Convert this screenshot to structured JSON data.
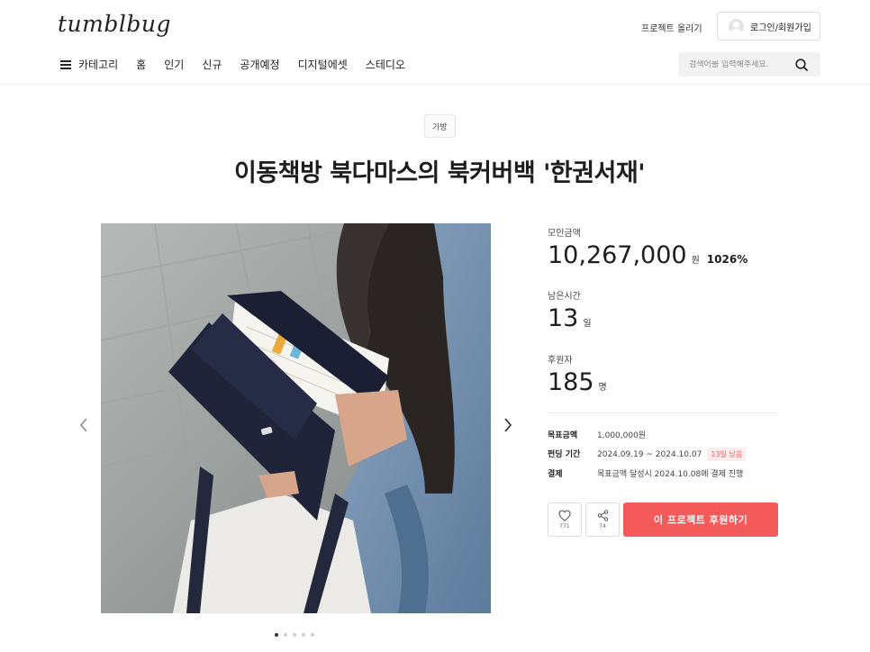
{
  "header": {
    "logo": "tumblbug",
    "project_link": "프로젝트 올리기",
    "login": "로그인/회원가입"
  },
  "nav": {
    "category": "카테고리",
    "items": [
      "홈",
      "인기",
      "신규",
      "공개예정",
      "디지털에셋",
      "스테디오"
    ]
  },
  "search": {
    "placeholder": "검색어를 입력해주세요."
  },
  "project": {
    "category_tag": "가방",
    "title": "이동책방 북다마스의 북커버백 '한권서재'"
  },
  "carousel": {
    "total": 5,
    "active": 1
  },
  "stats": {
    "amount_label": "모인금액",
    "amount": "10,267,000",
    "amount_unit": "원",
    "percent": "1026%",
    "remaining_label": "남은시간",
    "remaining": "13",
    "remaining_unit": "일",
    "backers_label": "후원자",
    "backers": "185",
    "backers_unit": "명"
  },
  "info": {
    "goal_label": "목표금액",
    "goal": "1,000,000원",
    "period_label": "펀딩 기간",
    "period": "2024.09.19 ~ 2024.10.07",
    "period_badge": "13일 남음",
    "payment_label": "결제",
    "payment": "목표금액 달성시 2024.10.08에 결제 진행"
  },
  "actions": {
    "like_count": "771",
    "share_count": "74",
    "back_button": "이 프로젝트 후원하기"
  },
  "colors": {
    "accent": "#f55a5a",
    "badge_bg": "#fdecec"
  }
}
